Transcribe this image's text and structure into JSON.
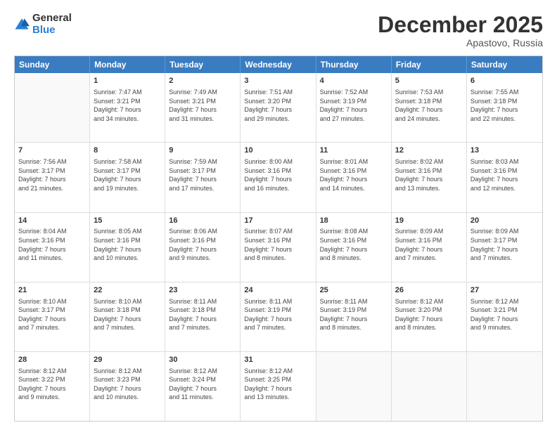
{
  "logo": {
    "general": "General",
    "blue": "Blue"
  },
  "header": {
    "month": "December 2025",
    "location": "Apastovo, Russia"
  },
  "days": [
    "Sunday",
    "Monday",
    "Tuesday",
    "Wednesday",
    "Thursday",
    "Friday",
    "Saturday"
  ],
  "rows": [
    [
      {
        "day": "",
        "content": ""
      },
      {
        "day": "1",
        "content": "Sunrise: 7:47 AM\nSunset: 3:21 PM\nDaylight: 7 hours\nand 34 minutes."
      },
      {
        "day": "2",
        "content": "Sunrise: 7:49 AM\nSunset: 3:21 PM\nDaylight: 7 hours\nand 31 minutes."
      },
      {
        "day": "3",
        "content": "Sunrise: 7:51 AM\nSunset: 3:20 PM\nDaylight: 7 hours\nand 29 minutes."
      },
      {
        "day": "4",
        "content": "Sunrise: 7:52 AM\nSunset: 3:19 PM\nDaylight: 7 hours\nand 27 minutes."
      },
      {
        "day": "5",
        "content": "Sunrise: 7:53 AM\nSunset: 3:18 PM\nDaylight: 7 hours\nand 24 minutes."
      },
      {
        "day": "6",
        "content": "Sunrise: 7:55 AM\nSunset: 3:18 PM\nDaylight: 7 hours\nand 22 minutes."
      }
    ],
    [
      {
        "day": "7",
        "content": "Sunrise: 7:56 AM\nSunset: 3:17 PM\nDaylight: 7 hours\nand 21 minutes."
      },
      {
        "day": "8",
        "content": "Sunrise: 7:58 AM\nSunset: 3:17 PM\nDaylight: 7 hours\nand 19 minutes."
      },
      {
        "day": "9",
        "content": "Sunrise: 7:59 AM\nSunset: 3:17 PM\nDaylight: 7 hours\nand 17 minutes."
      },
      {
        "day": "10",
        "content": "Sunrise: 8:00 AM\nSunset: 3:16 PM\nDaylight: 7 hours\nand 16 minutes."
      },
      {
        "day": "11",
        "content": "Sunrise: 8:01 AM\nSunset: 3:16 PM\nDaylight: 7 hours\nand 14 minutes."
      },
      {
        "day": "12",
        "content": "Sunrise: 8:02 AM\nSunset: 3:16 PM\nDaylight: 7 hours\nand 13 minutes."
      },
      {
        "day": "13",
        "content": "Sunrise: 8:03 AM\nSunset: 3:16 PM\nDaylight: 7 hours\nand 12 minutes."
      }
    ],
    [
      {
        "day": "14",
        "content": "Sunrise: 8:04 AM\nSunset: 3:16 PM\nDaylight: 7 hours\nand 11 minutes."
      },
      {
        "day": "15",
        "content": "Sunrise: 8:05 AM\nSunset: 3:16 PM\nDaylight: 7 hours\nand 10 minutes."
      },
      {
        "day": "16",
        "content": "Sunrise: 8:06 AM\nSunset: 3:16 PM\nDaylight: 7 hours\nand 9 minutes."
      },
      {
        "day": "17",
        "content": "Sunrise: 8:07 AM\nSunset: 3:16 PM\nDaylight: 7 hours\nand 8 minutes."
      },
      {
        "day": "18",
        "content": "Sunrise: 8:08 AM\nSunset: 3:16 PM\nDaylight: 7 hours\nand 8 minutes."
      },
      {
        "day": "19",
        "content": "Sunrise: 8:09 AM\nSunset: 3:16 PM\nDaylight: 7 hours\nand 7 minutes."
      },
      {
        "day": "20",
        "content": "Sunrise: 8:09 AM\nSunset: 3:17 PM\nDaylight: 7 hours\nand 7 minutes."
      }
    ],
    [
      {
        "day": "21",
        "content": "Sunrise: 8:10 AM\nSunset: 3:17 PM\nDaylight: 7 hours\nand 7 minutes."
      },
      {
        "day": "22",
        "content": "Sunrise: 8:10 AM\nSunset: 3:18 PM\nDaylight: 7 hours\nand 7 minutes."
      },
      {
        "day": "23",
        "content": "Sunrise: 8:11 AM\nSunset: 3:18 PM\nDaylight: 7 hours\nand 7 minutes."
      },
      {
        "day": "24",
        "content": "Sunrise: 8:11 AM\nSunset: 3:19 PM\nDaylight: 7 hours\nand 7 minutes."
      },
      {
        "day": "25",
        "content": "Sunrise: 8:11 AM\nSunset: 3:19 PM\nDaylight: 7 hours\nand 8 minutes."
      },
      {
        "day": "26",
        "content": "Sunrise: 8:12 AM\nSunset: 3:20 PM\nDaylight: 7 hours\nand 8 minutes."
      },
      {
        "day": "27",
        "content": "Sunrise: 8:12 AM\nSunset: 3:21 PM\nDaylight: 7 hours\nand 9 minutes."
      }
    ],
    [
      {
        "day": "28",
        "content": "Sunrise: 8:12 AM\nSunset: 3:22 PM\nDaylight: 7 hours\nand 9 minutes."
      },
      {
        "day": "29",
        "content": "Sunrise: 8:12 AM\nSunset: 3:23 PM\nDaylight: 7 hours\nand 10 minutes."
      },
      {
        "day": "30",
        "content": "Sunrise: 8:12 AM\nSunset: 3:24 PM\nDaylight: 7 hours\nand 11 minutes."
      },
      {
        "day": "31",
        "content": "Sunrise: 8:12 AM\nSunset: 3:25 PM\nDaylight: 7 hours\nand 13 minutes."
      },
      {
        "day": "",
        "content": ""
      },
      {
        "day": "",
        "content": ""
      },
      {
        "day": "",
        "content": ""
      }
    ]
  ]
}
